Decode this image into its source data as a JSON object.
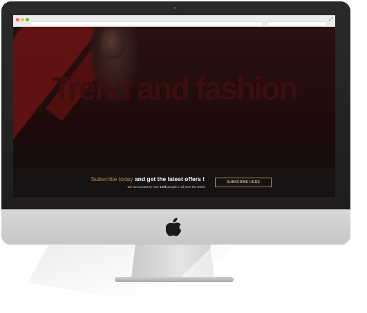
{
  "hero": {
    "headline": "Trend and fashion"
  },
  "subscribe": {
    "accent_text": "Subscribe today",
    "title_text": " and get the latest offers !",
    "trust_prefix": "We are trusted by over ",
    "trust_count": "100k",
    "trust_suffix": " people in all over the world",
    "button_label": "SUBSCRIBE HERE"
  },
  "colors": {
    "accent": "#b48a57",
    "hero_red": "#6b1313",
    "bezel": "#1c1c1c",
    "chin": "#d0d0d0"
  },
  "icons": {
    "window_controls": [
      "close-dot",
      "minimize-dot",
      "maximize-dot"
    ],
    "brand": "apple-logo-icon"
  }
}
